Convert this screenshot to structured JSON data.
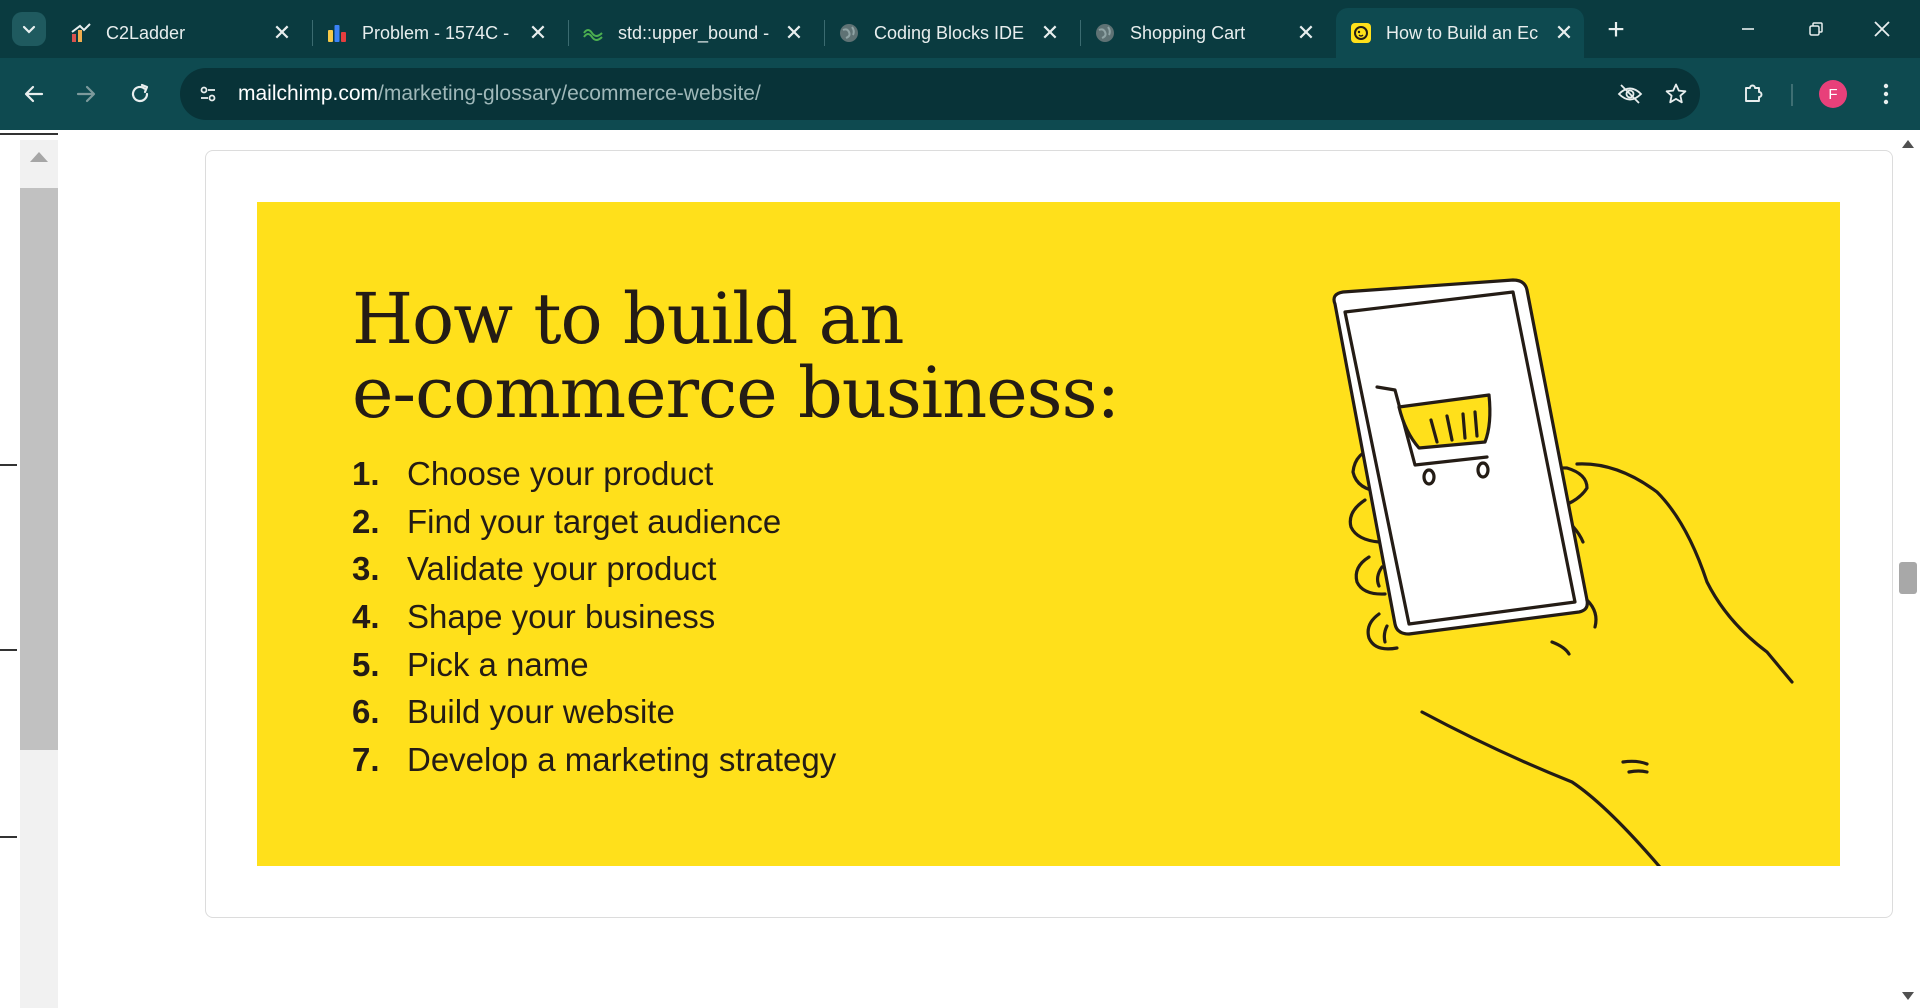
{
  "browser": {
    "tabs": [
      {
        "title": "C2Ladder",
        "icon": "chart-favicon-icon",
        "active": false
      },
      {
        "title": "Problem - 1574C -",
        "icon": "codeforces-icon",
        "active": false
      },
      {
        "title": "std::upper_bound -",
        "icon": "cpp-reference-icon",
        "active": false
      },
      {
        "title": "Coding Blocks IDE",
        "icon": "globe-icon",
        "active": false
      },
      {
        "title": "Shopping Cart",
        "icon": "globe-icon",
        "active": false
      },
      {
        "title": "How to Build an Ec",
        "icon": "mailchimp-icon",
        "active": true
      }
    ],
    "url_host": "mailchimp.com",
    "url_path": "/marketing-glossary/ecommerce-website/",
    "profile_initial": "F",
    "colors": {
      "frame": "#0a3b40",
      "toolbar": "#0e4a50",
      "avatar": "#e8407a"
    }
  },
  "content": {
    "heading_line1": "How to build an",
    "heading_line2": "e-commerce business:",
    "steps": [
      {
        "num": "1.",
        "text": "Choose your product"
      },
      {
        "num": "2.",
        "text": "Find your target audience"
      },
      {
        "num": "3.",
        "text": "Validate your product"
      },
      {
        "num": "4.",
        "text": "Shape your business"
      },
      {
        "num": "5.",
        "text": "Pick a name"
      },
      {
        "num": "6.",
        "text": "Build your website"
      },
      {
        "num": "7.",
        "text": "Develop a marketing strategy"
      }
    ],
    "banner_color": "#ffe01b"
  }
}
